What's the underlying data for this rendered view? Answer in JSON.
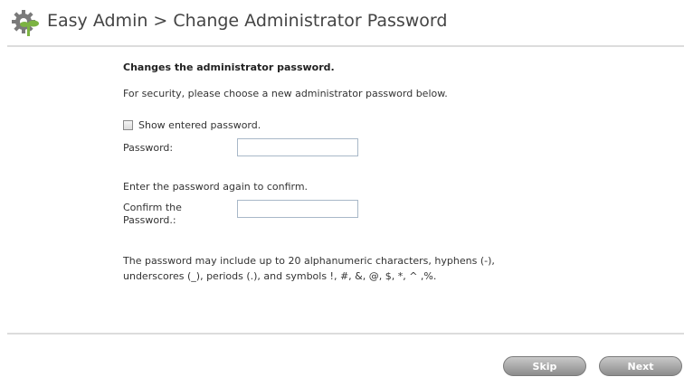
{
  "header": {
    "title": "Easy Admin > Change Administrator Password",
    "icon": "gear-plant-icon",
    "icon_colors": {
      "gear": "#7a7a7a",
      "plant": "#7cb342"
    }
  },
  "form": {
    "heading": "Changes the administrator password.",
    "intro": "For security, please choose a new administrator password below.",
    "show_password_label": "Show entered password.",
    "show_password_checked": false,
    "password_label": "Password:",
    "password_value": "",
    "confirm_instruction": "Enter the password again to confirm.",
    "confirm_label": "Confirm the Password.:",
    "confirm_value": "",
    "rules_text": "The password may include up to 20 alphanumeric characters, hyphens (-), underscores (_), periods (.), and symbols !, #, &, @, $, *, ^ ,%."
  },
  "footer": {
    "skip_label": "Skip",
    "next_label": "Next"
  },
  "colors": {
    "divider": "#dcdcdc",
    "button": "#a8a8a8",
    "input_border": "#a8b8c8"
  }
}
